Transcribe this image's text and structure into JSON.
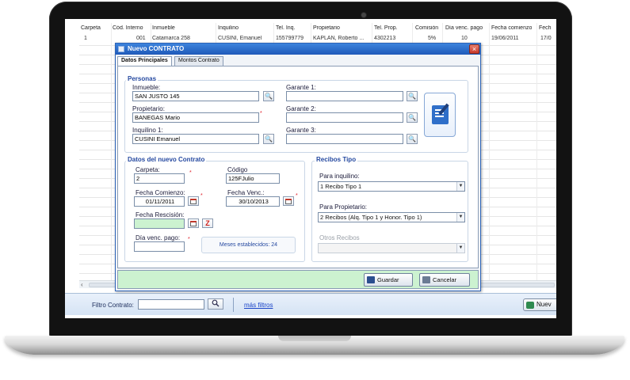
{
  "grid": {
    "columns": [
      "Carpeta",
      "Cód. Interno",
      "Inmueble",
      "Inquilino",
      "Tel. Inq.",
      "Propietario",
      "Tel. Prop.",
      "Comisión",
      "Día venc. pago",
      "Fecha comienzo",
      "Fech"
    ],
    "row": [
      "1",
      "001",
      "Catamarca 258",
      "CUSINI, Emanuel",
      "155799779",
      "KAPLAN, Roberto ...",
      "4302213",
      "5%",
      "10",
      "19/06/2011",
      "17/0"
    ]
  },
  "scroll": {
    "left_arrow": "‹"
  },
  "filter": {
    "label": "Filtro Contrato:",
    "value": "",
    "search_icon": "search-icon",
    "more_filters": "más filtros",
    "new_button": "Nuev"
  },
  "dialog": {
    "title": "Nuevo CONTRATO",
    "close": "×",
    "tabs": [
      "Datos Principales",
      "Montos Contrato"
    ],
    "personas": {
      "title": "Personas",
      "inmueble_label": "Inmueble:",
      "inmueble_value": "SAN JUSTO 145",
      "propietario_label": "Propietario:",
      "propietario_value": "BANEGAS Mario",
      "inquilino_label": "Inquilino 1:",
      "inquilino_value": "CUSINI Emanuel",
      "garante1_label": "Garante 1:",
      "garante1_value": "",
      "garante2_label": "Garante 2:",
      "garante2_value": "",
      "garante3_label": "Garante 3:",
      "garante3_value": "",
      "lookup_glyph": "🔍",
      "required_mark": "*"
    },
    "contrato": {
      "title": "Datos del nuevo Contrato",
      "carpeta_label": "Carpeta:",
      "carpeta_value": "2",
      "codigo_label": "Código",
      "codigo_value": "125FJulio",
      "fecha_comienzo_label": "Fecha Comienzo:",
      "fecha_comienzo_value": "01/11/2011",
      "fecha_venc_label": "Fecha Venc.:",
      "fecha_venc_value": "30/10/2013",
      "fecha_rescision_label": "Fecha Rescisión:",
      "fecha_rescision_value": "",
      "dia_venc_label": "Día venc. pago:",
      "dia_venc_value": "",
      "meses": "Meses establecidos: 24",
      "clear_glyph": "Z"
    },
    "recibos": {
      "title": "Recibos Tipo",
      "inquilino_label": "Para inquilino:",
      "inquilino_value": "1 Recibo Tipo 1",
      "propietario_label": "Para Propietario:",
      "propietario_value": "2 Recibos (Alq. Tipo 1 y Honor. Tipo 1)",
      "otros_label": "Otros Recibos",
      "otros_value": "",
      "arrow": "▼"
    },
    "buttons": {
      "guardar": "Guardar",
      "cancelar": "Cancelar"
    }
  }
}
